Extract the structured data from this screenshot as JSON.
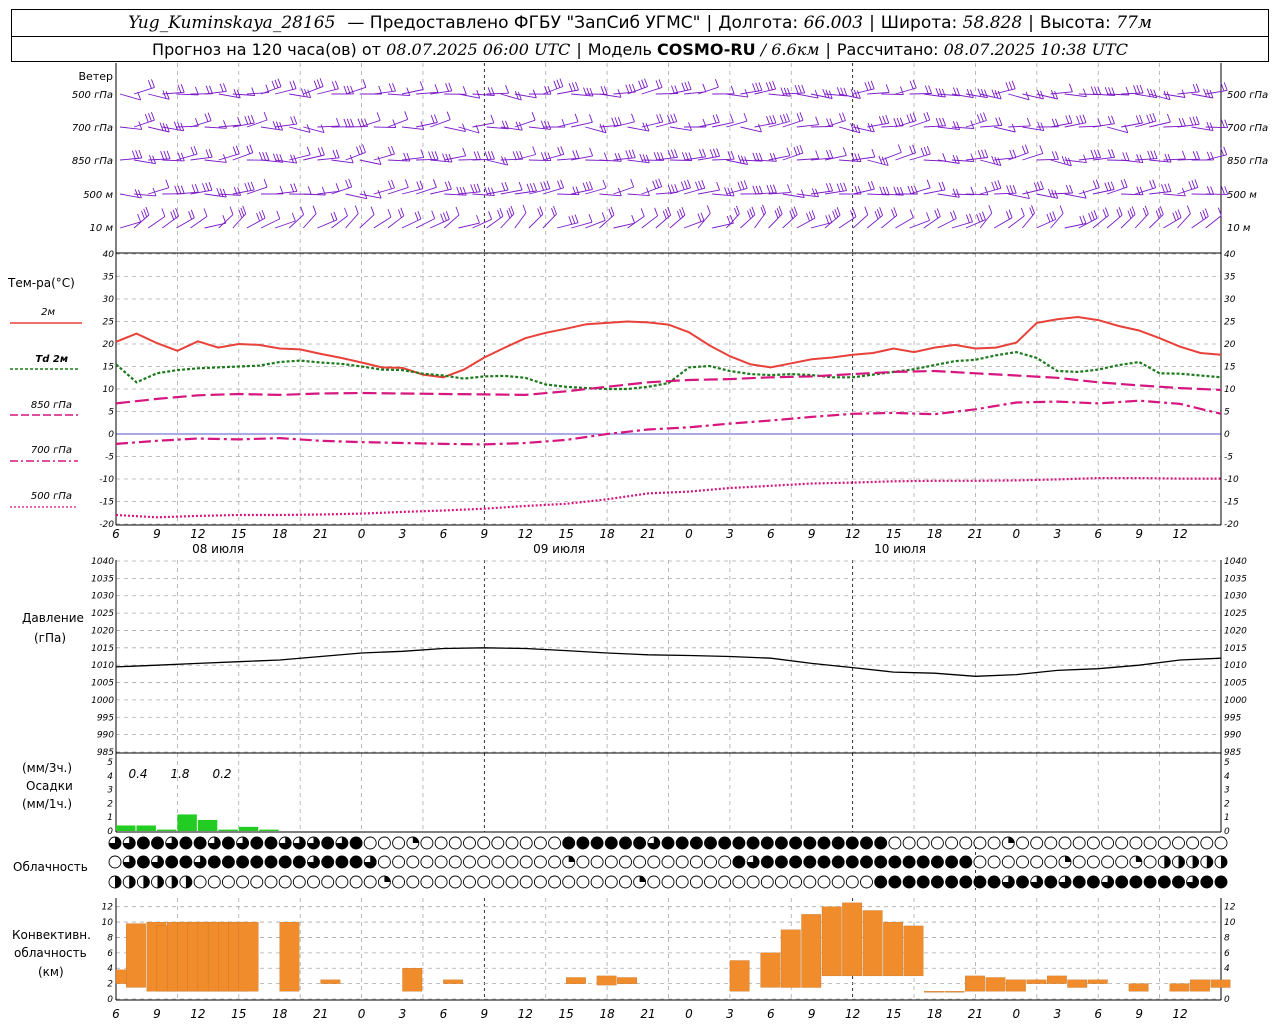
{
  "header": {
    "station": "Yug_Kuminskaya_28165",
    "provider": "— Предоставлено ФГБУ \"ЗапСиб УГМС\"",
    "lon_label": "Долгота:",
    "lon_value": "66.003",
    "lat_label": "Широта:",
    "lat_value": "58.828",
    "alt_label": "Высота:",
    "alt_value": "77м",
    "forecast_prefix": "Прогноз на 120 часа(ов) от",
    "forecast_time": "08.07.2025 06:00 UTC",
    "model_label": "Модель",
    "model_name": "COSMO-RU",
    "model_res": "/ 6.6км",
    "calc_label": "Рассчитано:",
    "calc_time": "08.07.2025 10:38 UTC"
  },
  "colors": {
    "wind": "#7a18c8",
    "t2m": "#e8413a",
    "td": "#1b7a1b",
    "upper": "#d6157f",
    "pressure": "#000000",
    "precip": "#22cc22",
    "convective": "#f08c2c",
    "zero_line": "#5555cc"
  },
  "wind_panel": {
    "title": "Ветер",
    "levels": [
      "500 гПа",
      "700 гПа",
      "850 гПа",
      "500 м",
      "10 м"
    ],
    "right_levels": [
      "500 гПа",
      "700 гПа",
      "850 гПа",
      "500 м",
      "10 м"
    ]
  },
  "temp_panel": {
    "title": "Тем-ра(°C)",
    "legend": {
      "t2m": "2м",
      "td": "Td  2м",
      "l850": "850 гПа",
      "l700": "700 гПа",
      "l500": "500 гПа"
    }
  },
  "time_axis": {
    "hour_labels": [
      "6",
      "9",
      "12",
      "15",
      "18",
      "21",
      "0",
      "3",
      "6",
      "9",
      "12",
      "15",
      "18",
      "21",
      "0",
      "3",
      "6",
      "9",
      "12",
      "15",
      "18",
      "21",
      "0",
      "3",
      "6",
      "9",
      "12"
    ],
    "date_labels": [
      "08 июля",
      "09 июля",
      "10 июля"
    ]
  },
  "pressure_panel": {
    "title_line1": "Давление",
    "title_line2": "(гПа)"
  },
  "precip_panel": {
    "unit_3h": "(мм/3ч.)",
    "title": "Осадки",
    "unit_1h": "(мм/1ч.)",
    "amount_labels": [
      "0.4",
      "1.8",
      "0.2"
    ]
  },
  "cloud_panel": {
    "title": "Облачность"
  },
  "convective_panel": {
    "title_line1": "Конвективн.",
    "title_line2": "облачность",
    "title_line3": "(км)"
  },
  "chart_data": [
    {
      "type": "line",
      "id": "temperature",
      "title": "Тем-ра(°C)",
      "x_unit": "hours from 08.07.2025 06:00 UTC",
      "x_range": [
        0,
        54
      ],
      "ylim": [
        -20,
        40
      ],
      "y_ticks": [
        -20,
        -15,
        -10,
        -5,
        0,
        5,
        10,
        15,
        20,
        25,
        30,
        35,
        40
      ],
      "grid": true,
      "series": [
        {
          "name": "2м",
          "key": "t2m",
          "x": [
            0,
            1,
            2,
            3,
            4,
            5,
            6,
            7,
            8,
            9,
            10,
            11,
            12,
            13,
            14,
            15,
            16,
            17,
            18,
            19,
            20,
            21,
            22,
            23,
            24,
            25,
            26,
            27,
            28,
            29,
            30,
            31,
            32,
            33,
            34,
            35,
            36,
            37,
            38,
            39,
            40,
            41,
            42,
            43,
            44,
            45,
            46,
            47,
            48,
            49,
            50,
            51,
            52,
            53,
            54
          ],
          "values": [
            20.5,
            22.3,
            20.2,
            18.5,
            20.6,
            19.2,
            20.0,
            19.8,
            19.0,
            18.8,
            17.8,
            16.9,
            15.9,
            14.8,
            14.7,
            13.2,
            12.6,
            14.3,
            17.0,
            19.2,
            21.3,
            22.5,
            23.4,
            24.4,
            24.7,
            25.0,
            24.8,
            24.3,
            22.6,
            19.7,
            17.3,
            15.5,
            14.8,
            15.7,
            16.6,
            17.0,
            17.6,
            18.0,
            19.0,
            18.2,
            19.2,
            19.8,
            19.0,
            19.2,
            20.3,
            24.7,
            25.5,
            26.0,
            25.3,
            24.0,
            23.0,
            21.3,
            19.4,
            18.0,
            17.6
          ]
        },
        {
          "name": "Td  2м",
          "key": "td",
          "x": [
            0,
            1,
            2,
            3,
            4,
            5,
            6,
            7,
            8,
            9,
            10,
            11,
            12,
            13,
            14,
            15,
            16,
            17,
            18,
            19,
            20,
            21,
            22,
            23,
            24,
            25,
            26,
            27,
            28,
            29,
            30,
            31,
            32,
            33,
            34,
            35,
            36,
            37,
            38,
            39,
            40,
            41,
            42,
            43,
            44,
            45,
            46,
            47,
            48,
            49,
            50,
            51,
            52,
            53,
            54
          ],
          "values": [
            15.5,
            11.5,
            13.5,
            14.2,
            14.6,
            14.8,
            15.0,
            15.2,
            16.0,
            16.3,
            15.9,
            15.6,
            15.0,
            14.3,
            14.2,
            13.4,
            13.0,
            12.3,
            12.8,
            12.9,
            12.5,
            11.0,
            10.5,
            10.2,
            10.0,
            10.0,
            10.5,
            11.3,
            14.8,
            15.1,
            14.0,
            13.3,
            13.1,
            13.3,
            13.1,
            12.6,
            12.6,
            13.2,
            13.8,
            14.4,
            15.3,
            16.2,
            16.5,
            17.5,
            18.2,
            16.9,
            14.0,
            13.8,
            14.3,
            15.3,
            16.0,
            13.5,
            13.4,
            13.0,
            12.6
          ]
        },
        {
          "name": "850 гПа",
          "key": "l850",
          "x": [
            0,
            2,
            4,
            6,
            8,
            10,
            12,
            14,
            16,
            18,
            20,
            22,
            24,
            26,
            28,
            30,
            32,
            34,
            36,
            38,
            40,
            42,
            44,
            46,
            48,
            50,
            52,
            54
          ],
          "values": [
            6.8,
            7.8,
            8.6,
            8.9,
            8.7,
            9.0,
            9.1,
            9.0,
            8.9,
            8.8,
            8.7,
            9.5,
            10.5,
            11.5,
            12.0,
            12.2,
            12.6,
            12.8,
            13.3,
            13.8,
            14.0,
            13.5,
            13.0,
            12.5,
            11.5,
            10.8,
            10.2,
            9.8
          ]
        },
        {
          "name": "700 гПа",
          "key": "l700",
          "x": [
            0,
            2,
            4,
            6,
            8,
            10,
            12,
            14,
            16,
            18,
            20,
            22,
            24,
            26,
            28,
            30,
            32,
            34,
            36,
            38,
            40,
            42,
            44,
            46,
            48,
            50,
            52,
            54
          ],
          "values": [
            -2.2,
            -1.5,
            -1.0,
            -1.2,
            -0.9,
            -1.5,
            -1.8,
            -2.0,
            -2.2,
            -2.3,
            -2.0,
            -1.3,
            0.0,
            1.0,
            1.5,
            2.3,
            3.0,
            3.8,
            4.5,
            4.7,
            4.4,
            5.5,
            7.0,
            7.2,
            6.8,
            7.4,
            6.7,
            4.5
          ]
        },
        {
          "name": "500 гПа",
          "key": "l500",
          "x": [
            0,
            2,
            4,
            6,
            8,
            10,
            12,
            14,
            16,
            18,
            20,
            22,
            24,
            26,
            28,
            30,
            32,
            34,
            36,
            38,
            40,
            42,
            44,
            46,
            48,
            50,
            52,
            54
          ],
          "values": [
            -18.0,
            -18.5,
            -18.2,
            -18.0,
            -18.0,
            -17.9,
            -17.7,
            -17.3,
            -17.0,
            -16.6,
            -16.0,
            -15.5,
            -14.5,
            -13.2,
            -12.8,
            -12.0,
            -11.5,
            -11.0,
            -10.8,
            -10.5,
            -10.4,
            -10.4,
            -10.3,
            -10.1,
            -9.8,
            -9.8,
            -9.9,
            -9.9
          ]
        }
      ]
    },
    {
      "type": "line",
      "id": "pressure",
      "title": "Давление (гПа)",
      "x_range": [
        0,
        54
      ],
      "ylim": [
        985,
        1040
      ],
      "y_ticks": [
        985,
        990,
        995,
        1000,
        1005,
        1010,
        1015,
        1020,
        1025,
        1030,
        1035,
        1040
      ],
      "grid": true,
      "series": [
        {
          "key": "pressure",
          "x": [
            0,
            2,
            4,
            6,
            8,
            10,
            12,
            14,
            16,
            18,
            20,
            22,
            24,
            26,
            28,
            30,
            32,
            34,
            36,
            38,
            40,
            42,
            44,
            46,
            48,
            50,
            52,
            54
          ],
          "values": [
            1009.5,
            1010.0,
            1010.5,
            1011.0,
            1011.5,
            1012.5,
            1013.5,
            1014.0,
            1014.8,
            1015.0,
            1014.8,
            1014.2,
            1013.5,
            1013.0,
            1012.8,
            1012.5,
            1012.0,
            1010.5,
            1009.3,
            1008.0,
            1007.7,
            1006.8,
            1007.3,
            1008.5,
            1009.0,
            1010.0,
            1011.5,
            1012.0
          ]
        }
      ]
    },
    {
      "type": "bar",
      "id": "precipitation",
      "title": "Осадки",
      "ylim": [
        0,
        5
      ],
      "y_ticks": [
        0,
        1,
        2,
        3,
        4,
        5
      ],
      "series": [
        {
          "key": "precip_1h",
          "x": [
            0,
            1,
            2,
            3,
            4,
            5,
            6,
            7
          ],
          "values": [
            0.4,
            0.4,
            0.1,
            1.2,
            0.8,
            0.1,
            0.3,
            0.1
          ]
        }
      ]
    },
    {
      "type": "bar",
      "id": "convective",
      "title": "Конвективн. облачность (км)",
      "ylim": [
        0,
        13
      ],
      "y_ticks": [
        0,
        2,
        4,
        6,
        8,
        10,
        12
      ],
      "series": [
        {
          "key": "conv_base_top",
          "x": [
            0.5,
            1,
            2,
            2.5,
            3,
            3.5,
            4,
            4.5,
            5,
            5.5,
            6,
            6.5,
            8.5,
            10.5,
            14.5,
            16.5,
            22.5,
            24,
            25,
            30.5,
            32,
            33,
            34,
            35,
            36,
            37,
            38,
            39,
            40,
            41,
            42,
            43,
            44,
            45,
            46,
            47,
            48,
            50,
            52,
            53,
            54
          ],
          "base": [
            2.0,
            1.5,
            1.0,
            1.0,
            1.0,
            1.0,
            1.0,
            1.0,
            1.0,
            1.0,
            1.0,
            1.0,
            1.0,
            2.0,
            1.0,
            2.0,
            2.0,
            1.8,
            2.0,
            1.0,
            1.5,
            1.5,
            1.5,
            3.0,
            3.0,
            3.0,
            3.0,
            3.0,
            1.0,
            1.0,
            1.0,
            1.0,
            1.0,
            2.0,
            2.0,
            1.5,
            2.0,
            1.0,
            1.0,
            1.0,
            1.5
          ],
          "top": [
            3.8,
            9.8,
            10.0,
            9.5,
            10.0,
            10.0,
            10.0,
            10.0,
            10.0,
            10.0,
            10.0,
            10.0,
            10.0,
            2.5,
            4.0,
            2.5,
            2.8,
            3.0,
            2.8,
            5.0,
            6.0,
            9.0,
            11.0,
            12.0,
            12.5,
            11.5,
            10.0,
            9.5,
            1.0,
            1.0,
            3.0,
            2.8,
            2.5,
            2.5,
            3.0,
            2.5,
            2.5,
            2.0,
            2.0,
            2.5,
            2.5
          ]
        }
      ]
    }
  ]
}
